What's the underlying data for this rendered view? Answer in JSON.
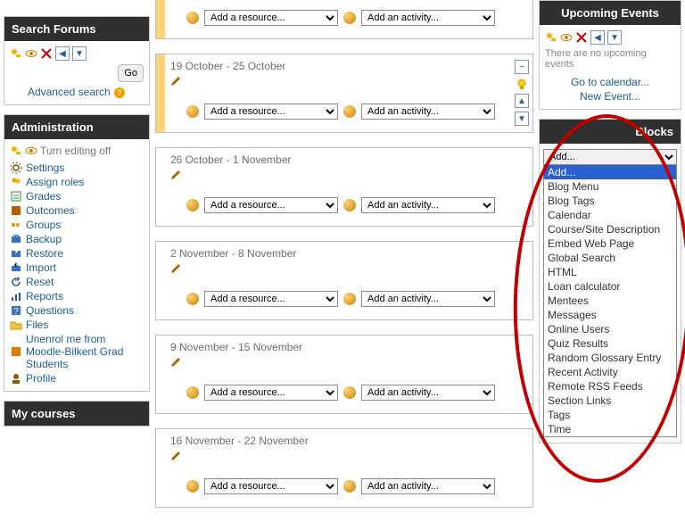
{
  "searchForums": {
    "title": "Search Forums",
    "go_label": "Go",
    "advanced_label": "Advanced search"
  },
  "administration": {
    "title": "Administration",
    "items": [
      {
        "key": "turn-editing",
        "label": "Turn editing off",
        "icon": "switch"
      },
      {
        "key": "settings",
        "label": "Settings",
        "icon": "gear"
      },
      {
        "key": "assign-roles",
        "label": "Assign roles",
        "icon": "roles"
      },
      {
        "key": "grades",
        "label": "Grades",
        "icon": "grades"
      },
      {
        "key": "outcomes",
        "label": "Outcomes",
        "icon": "outcomes"
      },
      {
        "key": "groups",
        "label": "Groups",
        "icon": "groups"
      },
      {
        "key": "backup",
        "label": "Backup",
        "icon": "backup"
      },
      {
        "key": "restore",
        "label": "Restore",
        "icon": "restore"
      },
      {
        "key": "import",
        "label": "Import",
        "icon": "import"
      },
      {
        "key": "reset",
        "label": "Reset",
        "icon": "reset"
      },
      {
        "key": "reports",
        "label": "Reports",
        "icon": "reports"
      },
      {
        "key": "questions",
        "label": "Questions",
        "icon": "questions"
      },
      {
        "key": "files",
        "label": "Files",
        "icon": "files"
      },
      {
        "key": "unenrol",
        "label": "Unenrol me from Moodle-Bilkent Grad Students",
        "icon": "unenrol"
      },
      {
        "key": "profile",
        "label": "Profile",
        "icon": "profile"
      }
    ]
  },
  "myCourses": {
    "title": "My courses"
  },
  "center": {
    "weeks": [
      {
        "label": "",
        "highlight": true,
        "tools": []
      },
      {
        "label": "19 October - 25 October",
        "highlight": true,
        "tools": [
          "minus",
          "bulb",
          "arrow-up",
          "arrow-down"
        ]
      },
      {
        "label": "26 October - 1 November",
        "highlight": false,
        "tools": []
      },
      {
        "label": "2 November - 8 November",
        "highlight": false,
        "tools": []
      },
      {
        "label": "9 November - 15 November",
        "highlight": false,
        "tools": []
      },
      {
        "label": "16 November - 22 November",
        "highlight": false,
        "tools": []
      }
    ],
    "resource_placeholder": "Add a resource...",
    "activity_placeholder": "Add an activity..."
  },
  "upcoming": {
    "title": "Upcoming Events",
    "empty_text": "There are no upcoming events",
    "cal_link": "Go to calendar...",
    "new_event": "New Event..."
  },
  "blocksPanel": {
    "title": "Blocks",
    "select_value": "Add...",
    "options": [
      "Add...",
      "Blog Menu",
      "Blog Tags",
      "Calendar",
      "Course/Site Description",
      "Embed Web Page",
      "Global Search",
      "HTML",
      "Loan calculator",
      "Mentees",
      "Messages",
      "Online Users",
      "Quiz Results",
      "Random Glossary Entry",
      "Recent Activity",
      "Remote RSS Feeds",
      "Section Links",
      "Tags",
      "Time"
    ],
    "selected_index": 0
  }
}
